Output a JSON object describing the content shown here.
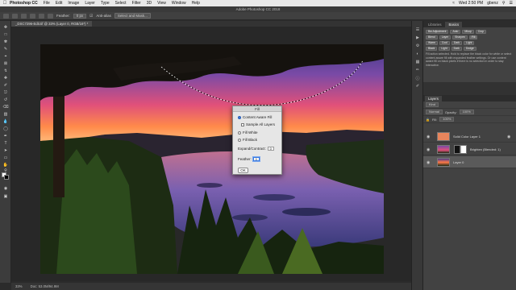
{
  "menubar": {
    "app": "Photoshop CC",
    "items": [
      "File",
      "Edit",
      "Image",
      "Layer",
      "Type",
      "Select",
      "Filter",
      "3D",
      "View",
      "Window",
      "Help"
    ],
    "clock": "Wed 2:50 PM",
    "user": "gbenz"
  },
  "window": {
    "title": "Adobe Photoshop CC 2018"
  },
  "options": {
    "feather_label": "Feather:",
    "feather_value": "0 px",
    "anti_alias": "Anti-alias",
    "select_mask": "Select and Mask..."
  },
  "document": {
    "tab": "_DSC7296-Edit.tif @ 33% (Layer 0, RGB/16*) *",
    "zoom": "33%",
    "doc_info": "Doc: 53.0M/94.9M"
  },
  "panels": {
    "tabs": [
      "Libraries",
      "Basics"
    ],
    "basics_rows": [
      [
        "Bw Adjustment",
        "Auto",
        "Mkup",
        "Crop"
      ],
      [
        "Blend",
        "Layer",
        "Sharpen",
        "Fill"
      ],
      [
        "Warm",
        "Cool",
        "Dark",
        "Light"
      ],
      [
        "Black",
        "Light",
        "Dark",
        "Dodge"
      ]
    ],
    "help_text": "Fill action selected. Hold to replace the black color for white or select content aware fill with expanded feather settings. Or use content aware fill on black pixels if there is no selection in order to stay interactive.",
    "layers_tab": "Layers",
    "kind_label": "Kind",
    "blend_mode": "Normal",
    "opacity_label": "Opacity:",
    "opacity_value": "100%",
    "fill_label": "Fill:",
    "fill_value": "100%",
    "layers": [
      {
        "name": "Solid Color Layer 1",
        "selected": false
      },
      {
        "name": "Brighten (Blended: 1)",
        "selected": false
      },
      {
        "name": "Layer 0",
        "selected": true
      }
    ]
  },
  "dialog": {
    "title": "Fill",
    "content_aware": "Content Aware Fill",
    "sample_all": "Sample All Layers",
    "fill_white": "Fill White",
    "fill_black": "Fill Black",
    "expand_label": "Expand/Contract:",
    "expand_value": "0",
    "feather_label": "Feather:",
    "feather_value": "0",
    "ok": "OK",
    "selected_option": "Content Aware Fill"
  },
  "colors": {
    "sky_top": "#4b3a8a",
    "sky_glow": "#ff7a4a",
    "water": "#6a5fb0",
    "forest": "#1a2a14"
  }
}
